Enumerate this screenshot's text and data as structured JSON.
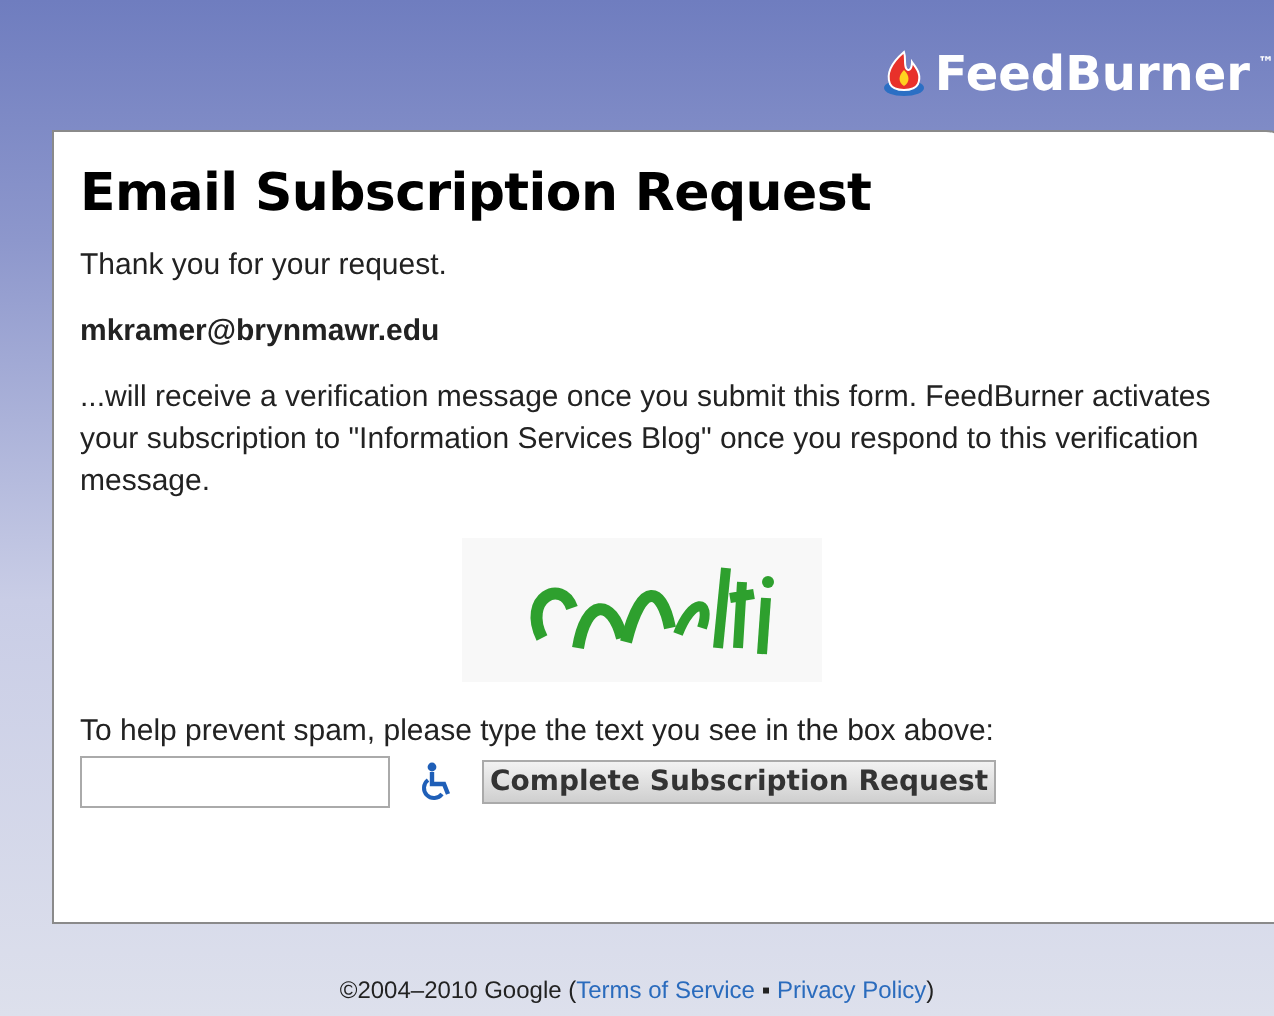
{
  "header": {
    "logo_text": "FeedBurner",
    "trademark": "™"
  },
  "card": {
    "title": "Email Subscription Request",
    "thanks": "Thank you for your request.",
    "email": "mkramer@brynmawr.edu",
    "message": "...will receive a verification message once you submit this form. FeedBurner activates your subscription to \"Information Services Blog\" once you respond to this verification message.",
    "prompt": "To help prevent spam, please type the text you see in the box above:",
    "submit_button": "Complete Subscription Request"
  },
  "footer": {
    "copyright": "©2004–2010 Google (",
    "links": [
      "Terms of Service",
      "Privacy Policy"
    ],
    "separator": "▪",
    "close": ")"
  }
}
